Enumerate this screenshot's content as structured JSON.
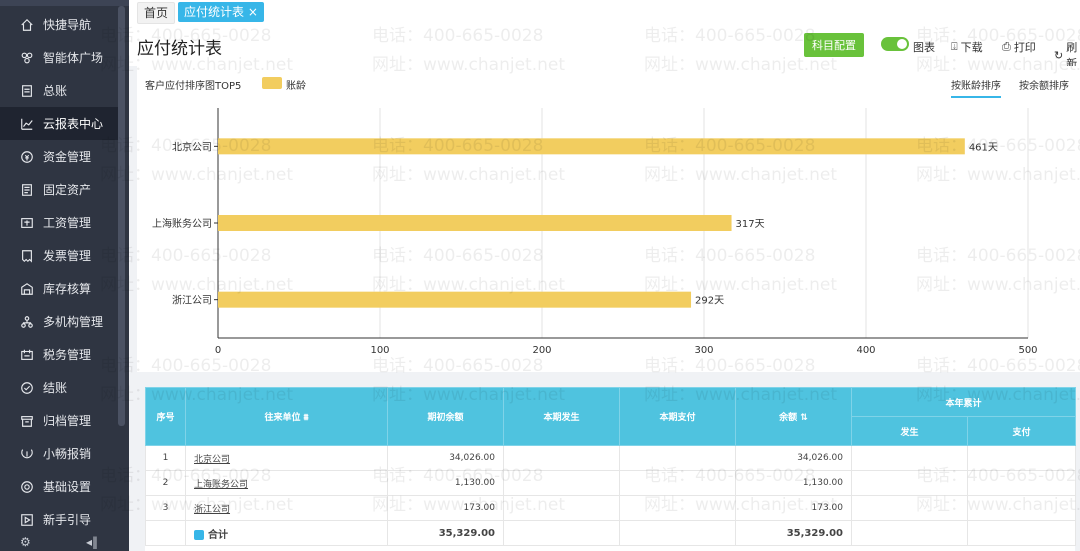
{
  "sidebar": {
    "items": [
      {
        "label": "快捷导航",
        "icon": "home-icon"
      },
      {
        "label": "智能体广场",
        "icon": "agent-icon"
      },
      {
        "label": "总账",
        "icon": "ledger-icon"
      },
      {
        "label": "云报表中心",
        "icon": "chart-icon",
        "active": true
      },
      {
        "label": "资金管理",
        "icon": "money-icon"
      },
      {
        "label": "固定资产",
        "icon": "asset-icon"
      },
      {
        "label": "工资管理",
        "icon": "salary-icon"
      },
      {
        "label": "发票管理",
        "icon": "invoice-icon"
      },
      {
        "label": "库存核算",
        "icon": "inventory-icon"
      },
      {
        "label": "多机构管理",
        "icon": "org-icon"
      },
      {
        "label": "税务管理",
        "icon": "tax-icon"
      },
      {
        "label": "结账",
        "icon": "close-account-icon"
      },
      {
        "label": "归档管理",
        "icon": "archive-icon"
      },
      {
        "label": "小畅报销",
        "icon": "reimburse-icon"
      },
      {
        "label": "基础设置",
        "icon": "settings-icon"
      },
      {
        "label": "新手引导",
        "icon": "guide-icon"
      }
    ]
  },
  "tabs": {
    "home": "首页",
    "current": "应付统计表",
    "close": "×"
  },
  "header": {
    "title": "应付统计表",
    "config_button": "科目配置",
    "chart_toggle_label": "图表",
    "download": "下载",
    "print": "打印",
    "refresh": "刷新"
  },
  "chart_panel": {
    "sort_by_age": "按账龄排序",
    "sort_by_balance": "按余额排序"
  },
  "chart_data": {
    "type": "bar",
    "orientation": "horizontal",
    "title": "客户应付排序图TOP5",
    "series": [
      {
        "name": "账龄",
        "values": [
          461,
          317,
          292
        ],
        "color": "#f2cd5f"
      }
    ],
    "categories": [
      "北京公司",
      "上海账务公司",
      "浙江公司"
    ],
    "value_suffix": "天",
    "xlim": [
      0,
      500
    ],
    "xticks": [
      0,
      100,
      200,
      300,
      400,
      500
    ],
    "grid": true,
    "legend": "top-left"
  },
  "table": {
    "headers": {
      "index": "序号",
      "unit": "往来单位",
      "opening": "期初余额",
      "period_occur": "本期发生",
      "period_pay": "本期支付",
      "balance": "余额",
      "year_total": "本年累计",
      "year_occur": "发生",
      "year_pay": "支付"
    },
    "rows": [
      {
        "index": "1",
        "unit": "北京公司",
        "opening": "34,026.00",
        "period_occur": "",
        "period_pay": "",
        "balance": "34,026.00",
        "year_occur": "",
        "year_pay": ""
      },
      {
        "index": "2",
        "unit": "上海账务公司",
        "opening": "1,130.00",
        "period_occur": "",
        "period_pay": "",
        "balance": "1,130.00",
        "year_occur": "",
        "year_pay": ""
      },
      {
        "index": "3",
        "unit": "浙江公司",
        "opening": "173.00",
        "period_occur": "",
        "period_pay": "",
        "balance": "173.00",
        "year_occur": "",
        "year_pay": ""
      }
    ],
    "total": {
      "label": "合计",
      "opening": "35,329.00",
      "balance": "35,329.00"
    }
  },
  "watermark": {
    "phone": "电话：400-665-0028",
    "site": "网址：www.chanjet.net"
  },
  "colors": {
    "accent": "#37b6e8",
    "green": "#69c23b",
    "bar": "#f2cd5f",
    "table_header": "#4fc3df",
    "sidebar": "#2f3542"
  }
}
